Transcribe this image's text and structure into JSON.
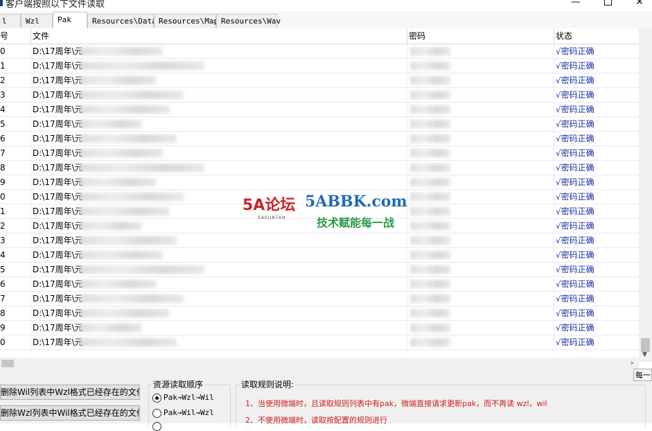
{
  "window": {
    "title": "客户端按照以下文件读取",
    "minimize": "—",
    "close": "✕"
  },
  "tabs": [
    {
      "label": "l"
    },
    {
      "label": "Wzl"
    },
    {
      "label": "Pak"
    },
    {
      "label": "Resources\\Data"
    },
    {
      "label": "Resources\\Map"
    },
    {
      "label": "Resources\\Wav"
    }
  ],
  "table": {
    "columns": {
      "no": "号",
      "file": "文件",
      "password": "密码",
      "status": "状态"
    },
    "rows": [
      {
        "no": "0",
        "file": "D:\\17周年\\元",
        "status": "√密码正确"
      },
      {
        "no": "1",
        "file": "D:\\17周年\\元",
        "status": "√密码正确"
      },
      {
        "no": "2",
        "file": "D:\\17周年\\元",
        "status": "√密码正确"
      },
      {
        "no": "3",
        "file": "D:\\17周年\\元",
        "status": "√密码正确"
      },
      {
        "no": "4",
        "file": "D:\\17周年\\元",
        "status": "√密码正确"
      },
      {
        "no": "5",
        "file": "D:\\17周年\\元",
        "status": "√密码正确"
      },
      {
        "no": "6",
        "file": "D:\\17周年\\元",
        "status": "√密码正确"
      },
      {
        "no": "7",
        "file": "D:\\17周年\\元",
        "status": "√密码正确"
      },
      {
        "no": "8",
        "file": "D:\\17周年\\元",
        "status": "√密码正确"
      },
      {
        "no": "9",
        "file": "D:\\17周年\\元",
        "status": "√密码正确"
      },
      {
        "no": "0",
        "file": "D:\\17周年\\元",
        "status": "√密码正确"
      },
      {
        "no": "1",
        "file": "D:\\17周年\\元",
        "status": "√密码正确"
      },
      {
        "no": "2",
        "file": "D:\\17周年\\元",
        "status": "√密码正确"
      },
      {
        "no": "3",
        "file": "D:\\17周年\\元",
        "status": "√密码正确"
      },
      {
        "no": "4",
        "file": "D:\\17周年\\元",
        "status": "√密码正确"
      },
      {
        "no": "5",
        "file": "D:\\17周年\\元",
        "status": "√密码正确"
      },
      {
        "no": "6",
        "file": "D:\\17周年\\元",
        "status": "√密码正确"
      },
      {
        "no": "7",
        "file": "D:\\17周年\\元",
        "status": "√密码正确"
      },
      {
        "no": "8",
        "file": "D:\\17周年\\元",
        "status": "√密码正确"
      },
      {
        "no": "9",
        "file": "D:\\17周年\\元",
        "status": "√密码正确"
      },
      {
        "no": "0",
        "file": "D:\\17周年\\元",
        "status": "√密码正确"
      }
    ]
  },
  "watermark": {
    "logo": "5A论坛",
    "logo_sub": "SAKUNTAN",
    "site": "5ABBK.com",
    "slogan": "技术赋能每一战"
  },
  "buttons": {
    "delete_wil": "删除Wil列表中Wzl格式已经存在的文件",
    "delete_wzl": "删除Wzl列表中Wil格式已经存在的文件"
  },
  "read_order": {
    "title": "资源读取顺序",
    "options": [
      "Pak→Wzl→Wil",
      "Pak→Wil→Wzl"
    ],
    "selected": 0
  },
  "rules": {
    "title": "读取规则说明:",
    "items": [
      "1、当使用微端时，且读取规则列表中有pak，微端直接请求更新pak，而不再读 wzl，wil",
      "2、不使用微端时，读取按配置的规则进行"
    ]
  },
  "tooltip_fragment": "每一"
}
